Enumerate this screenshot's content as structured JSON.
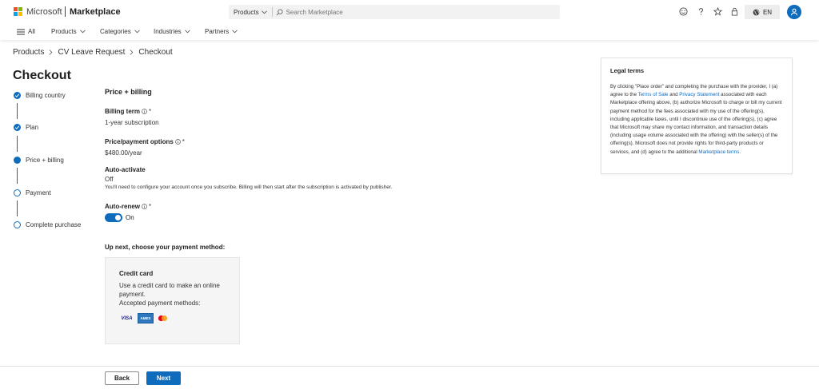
{
  "header": {
    "brand": "Microsoft",
    "product": "Marketplace",
    "search_scope": "Products",
    "search_placeholder": "Search Marketplace",
    "language": "EN"
  },
  "nav": {
    "all": "All",
    "items": [
      "Products",
      "Categories",
      "Industries",
      "Partners"
    ]
  },
  "breadcrumb": [
    "Products",
    "CV Leave Request",
    "Checkout"
  ],
  "page_title": "Checkout",
  "steps": [
    {
      "label": "Billing country",
      "state": "done"
    },
    {
      "label": "Plan",
      "state": "done"
    },
    {
      "label": "Price + billing",
      "state": "current"
    },
    {
      "label": "Payment",
      "state": "todo"
    },
    {
      "label": "Complete purchase",
      "state": "todo"
    }
  ],
  "form": {
    "section_title": "Price + billing",
    "billing_term_label": "Billing term",
    "billing_term_value": "1-year subscription",
    "price_label": "Price/payment options",
    "price_value": "$480.00/year",
    "auto_activate_label": "Auto-activate",
    "auto_activate_value": "Off",
    "auto_activate_note": "You'll need to configure your account once you subscribe. Billing will then start after the subscription is activated by publisher.",
    "auto_renew_label": "Auto-renew",
    "auto_renew_state": "On",
    "required_mark": "*",
    "up_next": "Up next, choose your payment method:"
  },
  "payment_card": {
    "title": "Credit card",
    "description": "Use a credit card to make an online payment.",
    "accepted": "Accepted payment methods:",
    "methods": [
      "VISA",
      "AMEX",
      "mastercard-icon"
    ]
  },
  "legal": {
    "title": "Legal terms",
    "text_1": "By clicking \"Place order\" and completing the purchase with the provider, I (a) agree to the ",
    "link_1": "Terms of Sale",
    "text_2": " and ",
    "link_2": "Privacy Statement",
    "text_3": " associated with each Marketplace offering above, (b) authorize Microsoft to charge or bill my current payment method for the fees associated with my use of the offering(s), including applicable taxes, until I discontinue use of the offering(s), (c) agree that Microsoft may share my contact information, and transaction details (including usage volume associated with the offering) with the seller(s) of the offering(s). Microsoft does not provide rights for third-party products or services, and (d) agree to the additional ",
    "link_3": "Marketplace terms",
    "text_4": "."
  },
  "footer": {
    "back": "Back",
    "next": "Next"
  },
  "colors": {
    "accent": "#0f6cbd",
    "logo_red": "#f25022",
    "logo_green": "#7fba00",
    "logo_blue": "#00a4ef",
    "logo_yellow": "#ffb900"
  }
}
